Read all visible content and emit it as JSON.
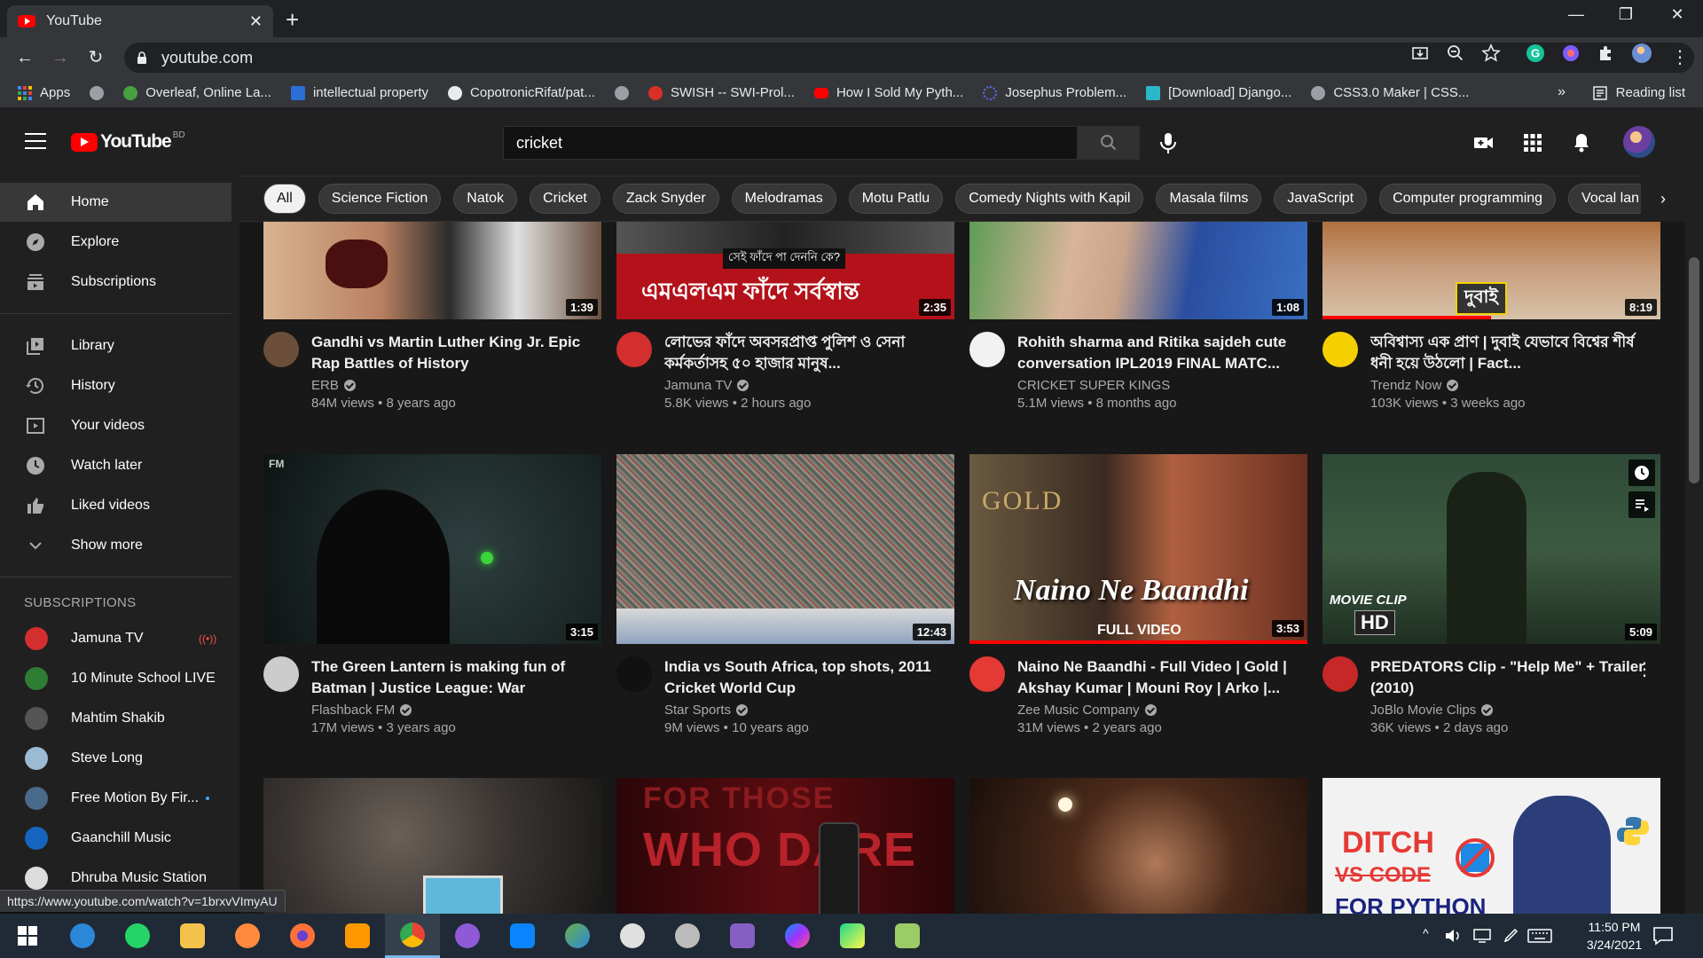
{
  "browser": {
    "tab_title": "YouTube",
    "new_tab": "+",
    "url": "youtube.com",
    "bookmarks": [
      {
        "label": "Apps",
        "color": "#4285f4"
      },
      {
        "label": "",
        "color": "#9aa0a6"
      },
      {
        "label": "Overleaf, Online La...",
        "color": "#47a141"
      },
      {
        "label": "intellectual property",
        "color": "#2b6fd6"
      },
      {
        "label": "CopotronicRifat/pat...",
        "color": "#e8eaed"
      },
      {
        "label": "",
        "color": "#9aa0a6"
      },
      {
        "label": "SWISH -- SWI-Prol...",
        "color": "#d93025"
      },
      {
        "label": "How I Sold My Pyth...",
        "color": "#ff0000"
      },
      {
        "label": "Josephus Problem...",
        "color": "#5f6cff"
      },
      {
        "label": "[Download] Django...",
        "color": "#2bb7c9"
      },
      {
        "label": "CSS3.0 Maker | CSS...",
        "color": "#9aa0a6"
      }
    ],
    "bookmarks_more": "»",
    "reading_list": "Reading list",
    "status_url": "https://www.youtube.com/watch?v=1brxvVImyAU"
  },
  "header": {
    "logo_text": "YouTube",
    "country": "BD",
    "search_value": "cricket"
  },
  "sidebar": {
    "main": [
      {
        "label": "Home",
        "icon": "home-icon"
      },
      {
        "label": "Explore",
        "icon": "explore-icon"
      },
      {
        "label": "Subscriptions",
        "icon": "subscriptions-icon"
      }
    ],
    "library": [
      {
        "label": "Library",
        "icon": "library-icon"
      },
      {
        "label": "History",
        "icon": "history-icon"
      },
      {
        "label": "Your videos",
        "icon": "your-videos-icon"
      },
      {
        "label": "Watch later",
        "icon": "watch-later-icon"
      },
      {
        "label": "Liked videos",
        "icon": "liked-videos-icon"
      },
      {
        "label": "Show more",
        "icon": "chevron-down-icon"
      }
    ],
    "subscriptions_title": "SUBSCRIPTIONS",
    "subscriptions": [
      {
        "label": "Jamuna TV",
        "color": "#d32f2f",
        "indicator": "live"
      },
      {
        "label": "10 Minute School LIVE",
        "color": "#2e7d32",
        "indicator": ""
      },
      {
        "label": "Mahtim Shakib",
        "color": "#555555",
        "indicator": ""
      },
      {
        "label": "Steve Long",
        "color": "#9bbbd4",
        "indicator": ""
      },
      {
        "label": "Free Motion By Fir...",
        "color": "#4a6a8a",
        "indicator": "new"
      },
      {
        "label": "Gaanchill Music",
        "color": "#1565c0",
        "indicator": ""
      },
      {
        "label": "Dhruba Music Station",
        "color": "#dddddd",
        "indicator": ""
      }
    ]
  },
  "chips": [
    "All",
    "Science Fiction",
    "Natok",
    "Cricket",
    "Zack Snyder",
    "Melodramas",
    "Motu Patlu",
    "Comedy Nights with Kapil",
    "Masala films",
    "JavaScript",
    "Computer programming",
    "Vocal lan"
  ],
  "videos": [
    {
      "title": "Gandhi vs Martin Luther King Jr. Epic Rap Battles of History",
      "channel": "ERB",
      "verified": true,
      "stats": "84M views • 8 years ago",
      "duration": "1:39",
      "thumb": "#8a6a55",
      "avatar": "#6b4f3a"
    },
    {
      "title": "লোভের ফাঁদে অবসরপ্রাপ্ত পুলিশ ও সেনা কর্মকর্তাসহ ৫০ হাজার মানুষ...",
      "channel": "Jamuna TV",
      "verified": true,
      "stats": "5.8K views • 2 hours ago",
      "duration": "2:35",
      "thumb": "#b3121a",
      "avatar": "#d32f2f"
    },
    {
      "title": "Rohith sharma and Ritika sajdeh cute conversation IPL2019 FINAL MATC...",
      "channel": "CRICKET SUPER KINGS",
      "verified": false,
      "stats": "5.1M views • 8 months ago",
      "duration": "1:08",
      "thumb": "#3f7a3a",
      "avatar": "#f2f2f2"
    },
    {
      "title": "অবিশ্বাস্য এক প্রাণ | দুবাই যেভাবে বিশ্বের শীর্ষ ধনী হয়ে উঠলো | Fact...",
      "channel": "Trendz Now",
      "verified": true,
      "stats": "103K views • 3 weeks ago",
      "duration": "8:19",
      "thumb": "#b07040",
      "avatar": "#f5d000"
    },
    {
      "title": "The Green Lantern is making fun of Batman | Justice League: War",
      "channel": "Flashback FM",
      "verified": true,
      "stats": "17M views • 3 years ago",
      "duration": "3:15",
      "thumb": "#1d2a2a",
      "avatar": "#cccccc"
    },
    {
      "title": "India vs South Africa, top shots, 2011 Cricket World Cup",
      "channel": "Star Sports",
      "verified": true,
      "stats": "9M views • 10 years ago",
      "duration": "12:43",
      "thumb": "#6a6e66",
      "avatar": "#111111"
    },
    {
      "title": "Naino Ne Baandhi - Full Video | Gold | Akshay Kumar | Mouni Roy | Arko |...",
      "channel": "Zee Music Company",
      "verified": true,
      "stats": "31M views • 2 years ago",
      "duration": "3:53",
      "thumb": "#5a3a2a",
      "avatar": "#e53935"
    },
    {
      "title": "PREDATORS Clip - \"Help Me\" + Trailer (2010)",
      "channel": "JoBlo Movie Clips",
      "verified": true,
      "stats": "36K views • 2 days ago",
      "duration": "5:09",
      "thumb": "#2e4a38",
      "avatar": "#c62828"
    },
    {
      "title": "",
      "channel": "",
      "verified": false,
      "stats": "",
      "duration": "",
      "thumb": "#3a3532",
      "avatar": ""
    },
    {
      "title": "",
      "channel": "",
      "verified": false,
      "stats": "",
      "duration": "",
      "thumb": "#3a0a0c",
      "avatar": ""
    },
    {
      "title": "",
      "channel": "",
      "verified": false,
      "stats": "",
      "duration": "",
      "thumb": "#2a1a12",
      "avatar": ""
    },
    {
      "title": "",
      "channel": "",
      "verified": false,
      "stats": "",
      "duration": "",
      "thumb": "#f2f2f2",
      "avatar": ""
    }
  ],
  "thumb_texts": {
    "ml": "এমএলএম ফাঁদে সর্বস্বান্ত",
    "ml_top": "সেই ফাঁদে পা দেননি কে?",
    "dubai": "দুবাই",
    "naino": "Naino Ne Baandhi",
    "naino_sub": "FULL VIDEO",
    "gold": "GOLD",
    "movie_clip": "MOVIE CLIP",
    "hd": "HD",
    "ditch": "DITCH",
    "vscode": "VS CODE",
    "forpython": "FOR PYTHON",
    "forthose": "FOR THOSE",
    "who_dare": "WHO DARE",
    "fm": "FM"
  },
  "taskbar": {
    "time": "11:50 PM",
    "date": "3/24/2021",
    "apps": [
      {
        "name": "edge-app",
        "color": "#2b88d8"
      },
      {
        "name": "whatsapp-app",
        "color": "#25d366"
      },
      {
        "name": "file-explorer-app",
        "color": "#f4c14d"
      },
      {
        "name": "brave-app",
        "color": "#ff8a3d"
      },
      {
        "name": "firefox-app",
        "color": "#ff7139"
      },
      {
        "name": "sublime-app",
        "color": "#ff9800"
      },
      {
        "name": "chrome-app",
        "color": "#4caf50"
      },
      {
        "name": "github-desktop-app",
        "color": "#8e5ad8"
      },
      {
        "name": "vscode-app",
        "color": "#0a84ff"
      },
      {
        "name": "maps-app",
        "color": "#6ab04c"
      },
      {
        "name": "paint-app",
        "color": "#e0e0e0"
      },
      {
        "name": "inkscape-app",
        "color": "#bbbbbb"
      },
      {
        "name": "visual-studio-app",
        "color": "#865fc5"
      },
      {
        "name": "messenger-app",
        "color": "#8a5cf6"
      },
      {
        "name": "pycharm-app",
        "color": "#21d789"
      },
      {
        "name": "notepad-app",
        "color": "#9ccc65"
      }
    ]
  }
}
